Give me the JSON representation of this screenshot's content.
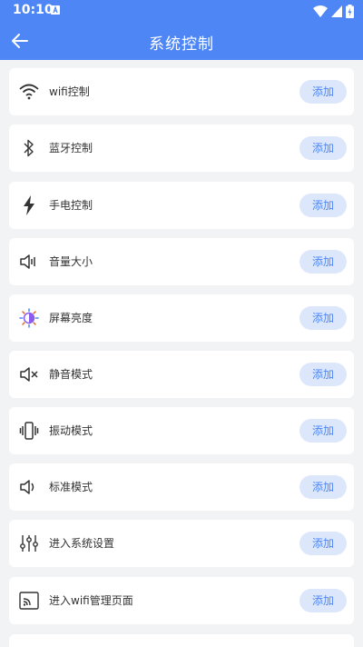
{
  "status": {
    "time": "10:10"
  },
  "header": {
    "title": "系统控制"
  },
  "items": [
    {
      "label": "wifi控制",
      "icon": "wifi-icon",
      "button": "添加"
    },
    {
      "label": "蓝牙控制",
      "icon": "bluetooth-icon",
      "button": "添加"
    },
    {
      "label": "手电控制",
      "icon": "flashlight-icon",
      "button": "添加"
    },
    {
      "label": "音量大小",
      "icon": "volume-icon",
      "button": "添加"
    },
    {
      "label": "屏幕亮度",
      "icon": "brightness-icon",
      "button": "添加"
    },
    {
      "label": "静音模式",
      "icon": "mute-icon",
      "button": "添加"
    },
    {
      "label": "振动模式",
      "icon": "vibrate-icon",
      "button": "添加"
    },
    {
      "label": "标准模式",
      "icon": "sound-icon",
      "button": "添加"
    },
    {
      "label": "进入系统设置",
      "icon": "settings-sliders-icon",
      "button": "添加"
    },
    {
      "label": "进入wifi管理页面",
      "icon": "wifi-settings-icon",
      "button": "添加"
    }
  ],
  "colors": {
    "primary": "#4e86f5",
    "button_bg": "#dde7fb",
    "background": "#f2f3f5"
  }
}
